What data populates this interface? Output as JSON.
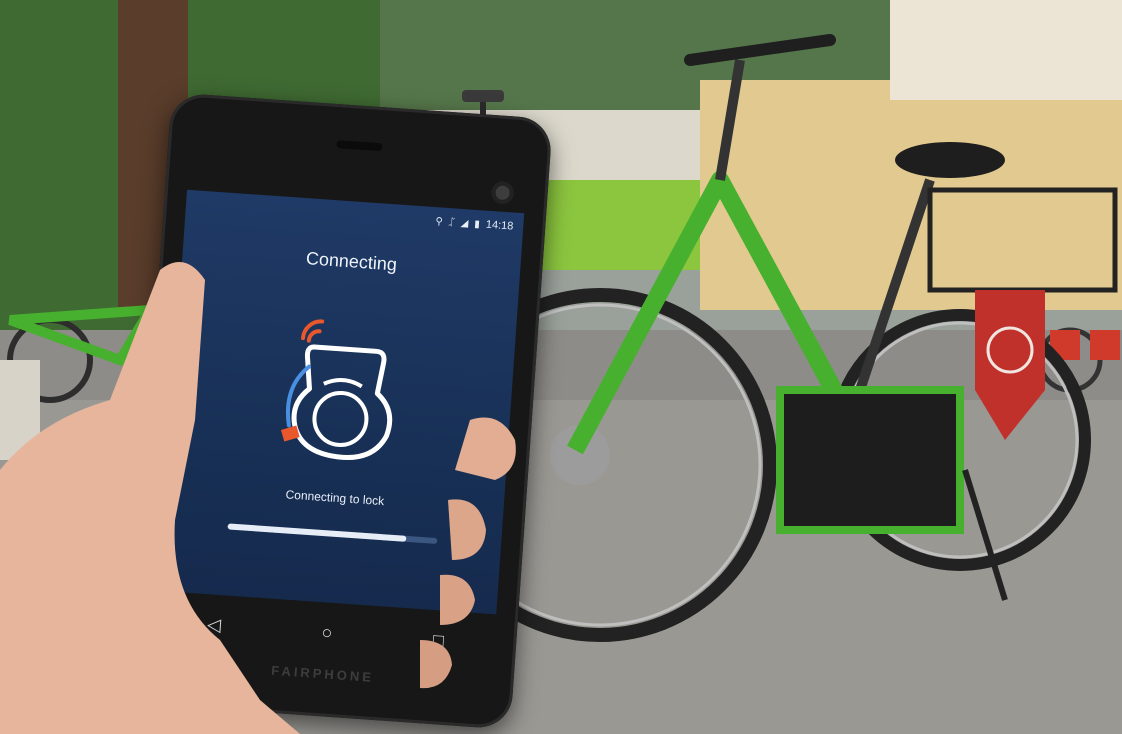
{
  "phone": {
    "status_bar": {
      "icons": [
        "location-icon",
        "bluetooth-icon",
        "signal-icon",
        "battery-icon"
      ],
      "time": "14:18"
    },
    "screen_title": "Connecting",
    "lock_icon": "bike-lock-icon",
    "status_message": "Connecting to lock",
    "progress_fraction": 0.85,
    "nav_buttons": {
      "back": "◁",
      "home": "○",
      "recents": "□"
    },
    "brand": "FAIRPHONE"
  },
  "colors": {
    "screen_background": "#1c355f",
    "bike_frame": "#47b02e",
    "red_tag": "#c1312c"
  }
}
